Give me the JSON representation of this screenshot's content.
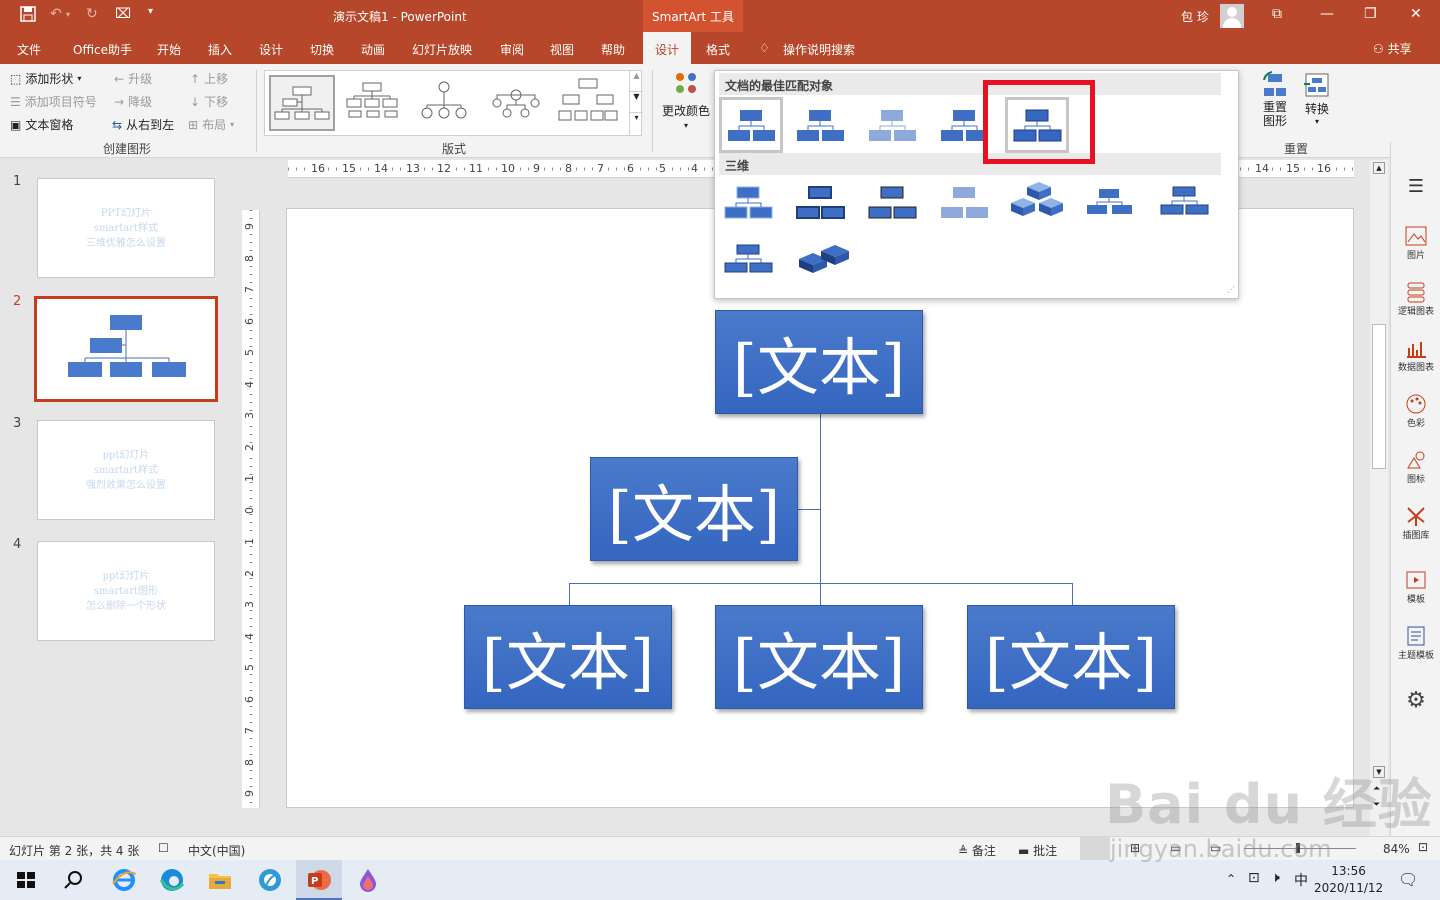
{
  "titlebar": {
    "doc_title": "演示文稿1  -  PowerPoint",
    "context_tab": "SmartArt 工具",
    "user": "包 珍"
  },
  "tabs": [
    "文件",
    "Office助手",
    "开始",
    "插入",
    "设计",
    "切换",
    "动画",
    "幻灯片放映",
    "审阅",
    "视图",
    "帮助",
    "设计",
    "格式"
  ],
  "tell_me": "操作说明搜索",
  "share": "共享",
  "ribbon": {
    "create": {
      "add_shape": "添加形状",
      "add_bullet": "添加项目符号",
      "text_pane": "文本窗格",
      "promote": "升级",
      "demote": "降级",
      "rtl": "从右到左",
      "move_up": "上移",
      "move_down": "下移",
      "layout": "布局",
      "group": "创建图形"
    },
    "layouts_group": "版式",
    "change_colors": "更改颜色",
    "reset_graphic": "重置\n图形",
    "convert": "转换",
    "reset_group": "重置"
  },
  "gallery": {
    "best_match": "文档的最佳匹配对象",
    "three_d": "三维"
  },
  "slides": [
    {
      "num": "1",
      "lines": [
        "PPT幻灯片",
        "smartart样式",
        "三维优雅怎么设置"
      ]
    },
    {
      "num": "2",
      "lines": []
    },
    {
      "num": "3",
      "lines": [
        "ppt幻灯片",
        "smartart样式",
        "强烈效果怎么设置"
      ]
    },
    {
      "num": "4",
      "lines": [
        "ppt幻灯片",
        "smartart图形",
        "怎么删除一个形状"
      ]
    }
  ],
  "node_text": "[文本]",
  "hruler_labels": [
    "16",
    "15",
    "14",
    "13",
    "12",
    "11",
    "10",
    "9",
    "8",
    "7",
    "6",
    "5",
    "4",
    "14",
    "15",
    "16"
  ],
  "vruler_labels": [
    "9",
    "8",
    "7",
    "6",
    "5",
    "4",
    "3",
    "2",
    "1",
    "0",
    "1",
    "2",
    "3",
    "4",
    "5",
    "6",
    "7",
    "8",
    "9"
  ],
  "right_pane": [
    "图片",
    "逻辑图表",
    "数据图表",
    "色彩",
    "图标",
    "插图库",
    "模板",
    "主题模板"
  ],
  "status": {
    "slide_info": "幻灯片 第 2 张，共 4 张",
    "language": "中文(中国)",
    "notes": "备注",
    "comments": "批注",
    "zoom": "84%"
  },
  "taskbar": {
    "time": "13:56",
    "date": "2020/11/12",
    "ime": "中"
  },
  "watermark": {
    "main": "Bai du 经验",
    "url": "jingyan.baidu.com"
  },
  "colors": {
    "accent": "#b7472a",
    "node": "#3f6fc4",
    "highlight": "#e81123"
  }
}
